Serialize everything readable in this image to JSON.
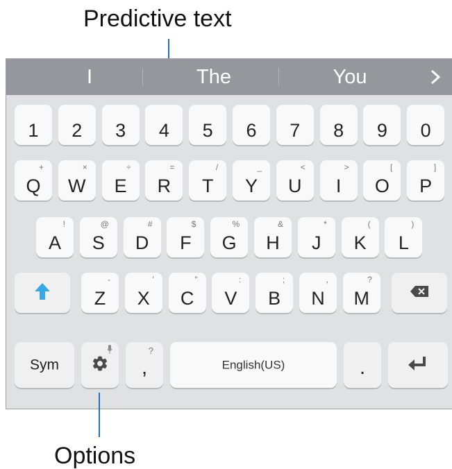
{
  "callouts": {
    "top": "Predictive text",
    "bottom": "Options"
  },
  "prediction_bar": {
    "suggestions": [
      "I",
      "The",
      "You"
    ],
    "expand_icon": "chevron-right-icon"
  },
  "keyboard": {
    "number_row": [
      "1",
      "2",
      "3",
      "4",
      "5",
      "6",
      "7",
      "8",
      "9",
      "0"
    ],
    "row_q": [
      {
        "main": "Q",
        "sub": "+"
      },
      {
        "main": "W",
        "sub": "×"
      },
      {
        "main": "E",
        "sub": "÷"
      },
      {
        "main": "R",
        "sub": "="
      },
      {
        "main": "T",
        "sub": "/"
      },
      {
        "main": "Y",
        "sub": "_"
      },
      {
        "main": "U",
        "sub": "<"
      },
      {
        "main": "I",
        "sub": ">"
      },
      {
        "main": "O",
        "sub": "["
      },
      {
        "main": "P",
        "sub": "]"
      }
    ],
    "row_a": [
      {
        "main": "A",
        "sub": "!"
      },
      {
        "main": "S",
        "sub": "@"
      },
      {
        "main": "D",
        "sub": "#"
      },
      {
        "main": "F",
        "sub": "$"
      },
      {
        "main": "G",
        "sub": "%"
      },
      {
        "main": "H",
        "sub": "&"
      },
      {
        "main": "J",
        "sub": "*"
      },
      {
        "main": "K",
        "sub": "("
      },
      {
        "main": "L",
        "sub": ")"
      }
    ],
    "row_z": [
      {
        "main": "Z",
        "sub": "-"
      },
      {
        "main": "X",
        "sub": "'"
      },
      {
        "main": "C",
        "sub": "\""
      },
      {
        "main": "V",
        "sub": ":"
      },
      {
        "main": "B",
        "sub": ";"
      },
      {
        "main": "N",
        "sub": ","
      },
      {
        "main": "M",
        "sub": "?"
      }
    ],
    "bottom_row": {
      "sym_label": "Sym",
      "comma_label": ",",
      "comma_sub": "?",
      "space_label": "English(US)",
      "period_label": "."
    },
    "icons": {
      "shift": "shift-arrow-icon",
      "backspace": "backspace-icon",
      "settings": "gear-icon",
      "mic": "microphone-icon",
      "enter": "enter-icon"
    },
    "colors": {
      "shift_accent": "#37a7e6",
      "prediction_bar": "#94989c",
      "callout_line": "#2a6db5"
    }
  }
}
